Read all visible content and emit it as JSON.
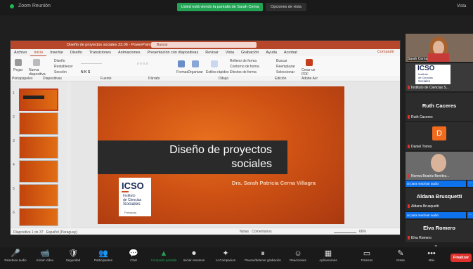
{
  "zoom_top": {
    "meeting_title": "Zoom Reunión",
    "banner": "Usted está viendo la pantalla de Sarah Cerna",
    "view_options": "Opciones de vista",
    "view_right": "Vista"
  },
  "ppt": {
    "doc_title": "Diseño de proyectos sociales 23.06  -  PowerPoint",
    "search": "Buscar",
    "menu": [
      "Archivo",
      "Inicio",
      "Insertar",
      "Diseño",
      "Transiciones",
      "Animaciones",
      "Presentación con diapositivas",
      "Revisar",
      "Vista",
      "Grabación",
      "Ayuda",
      "Acrobat"
    ],
    "share": "Compartir",
    "ribbon": {
      "pegar": "Pegar",
      "nueva_diap": "Nueva diapositiva",
      "diseno": "Diseño",
      "restablecer": "Restablecer",
      "seccion": "Sección",
      "formas": "Formas",
      "organizar": "Organizar",
      "estilos": "Estilos rápidos",
      "relleno": "Relleno de forma",
      "contorno": "Contorno de forma",
      "efectos": "Efectos de forma",
      "buscar": "Buscar",
      "reemplazar": "Reemplazar",
      "seleccionar": "Seleccionar",
      "crear_pdf": "Crear un PDF",
      "groups": [
        "Portapapeles",
        "Diapositivas",
        "Fuente",
        "Párrafo",
        "Dibujo",
        "Edición",
        "Adobe Acr"
      ]
    },
    "thumb_numbers": [
      "1",
      "2",
      "3",
      "4",
      "5",
      "6"
    ],
    "slide": {
      "title_line1": "Diseño de proyectos",
      "title_line2": "sociales",
      "subtitle": "Dra. Sarah Patricia Cerna Villagra",
      "logo_main": "ICSO",
      "logo_l1": "Instituto",
      "logo_l2": "de Ciencias",
      "logo_l3": "Sociales",
      "logo_l4": "Paraguay"
    },
    "status": {
      "slide_count": "Diapositiva 1 de 37",
      "lang": "Español (Paraguay)",
      "notas": "Notas",
      "comentarios": "Comentarios",
      "zoom": "66%"
    }
  },
  "participants": {
    "sarah_name": "Sarah Cerna",
    "icso_tile_l1": "ICSO",
    "icso_tile_l2": "Instituto",
    "icso_tile_l3": "de Ciencias",
    "icso_tile_l4": "Sociales",
    "icso_name": "Instituto de Ciencias S...",
    "ruth_big": "Ruth Caceres",
    "ruth_name": "Ruth Caceres",
    "daniel_letter": "D",
    "daniel_name": "Daniel Torres",
    "norma_name": "Norma Beatriz Benítez...",
    "unmute1": "ar para reactivar audio",
    "aldana_big": "Aldana Brusquetti",
    "aldana_name": "Aldana Brusquetti",
    "unmute2": "ar para reactivar audio",
    "elva_big": "Elva Romero",
    "elva_name": "Elva Romero",
    "chevron": "⌄"
  },
  "toolbar": {
    "items": [
      {
        "icon": "🎤",
        "label": "Reactivar audio"
      },
      {
        "icon": "📹",
        "label": "Iniciar vídeo"
      },
      {
        "icon": "🛡",
        "label": "Seguridad"
      },
      {
        "icon": "👥",
        "label": "Participantes"
      },
      {
        "icon": "💬",
        "label": "Chat"
      },
      {
        "icon": "▲",
        "label": "Compartir pantalla"
      },
      {
        "icon": "⏺",
        "label": "Iniciar resumen"
      },
      {
        "icon": "✦",
        "label": "AI Companion"
      },
      {
        "icon": "⏸",
        "label": "Pausar/detener grabación"
      },
      {
        "icon": "☺",
        "label": "Reacciones"
      },
      {
        "icon": "▦",
        "label": "Aplicaciones"
      },
      {
        "icon": "▭",
        "label": "Pizarras"
      },
      {
        "icon": "✎",
        "label": "Notas"
      },
      {
        "icon": "•••",
        "label": "Más"
      }
    ],
    "end": "Finalizar"
  },
  "colors": {
    "ppt_accent": "#b7472a",
    "zoom_green": "#23a455",
    "zoom_blue": "#0e72ed",
    "end_red": "#e0312c",
    "slide_orange": "#d95a16"
  }
}
